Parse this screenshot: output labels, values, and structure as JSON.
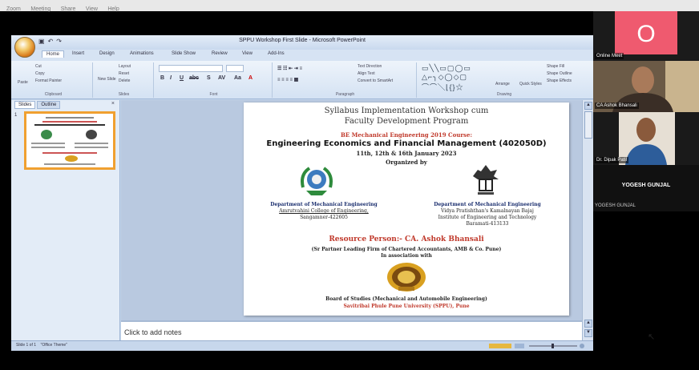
{
  "os_menu": [
    "Zoom",
    "Meeting",
    "Share",
    "View",
    "Help"
  ],
  "window": {
    "title": "SPPU Workshop First Slide - Microsoft PowerPoint",
    "tabs": [
      "Home",
      "Insert",
      "Design",
      "Animations",
      "Slide Show",
      "Review",
      "View",
      "Add-Ins"
    ]
  },
  "ribbon": {
    "clipboard": {
      "cut": "Cut",
      "copy": "Copy",
      "paste": "Paste",
      "format_painter": "Format Painter",
      "label": "Clipboard"
    },
    "slides": {
      "layout": "Layout",
      "reset": "Reset",
      "new_slide": "New Slide",
      "delete": "Delete",
      "label": "Slides"
    },
    "font": {
      "label": "Font"
    },
    "paragraph": {
      "text_direction": "Text Direction",
      "align_text": "Align Text",
      "convert_smartart": "Convert to SmartArt",
      "label": "Paragraph"
    },
    "drawing": {
      "arrange": "Arrange",
      "quick_styles": "Quick Styles",
      "shape_fill": "Shape Fill",
      "shape_outline": "Shape Outline",
      "shape_effects": "Shape Effects",
      "label": "Drawing"
    }
  },
  "pane": {
    "tabs": [
      "Slides",
      "Outline"
    ],
    "slide_number": "1"
  },
  "slide": {
    "title1": "Syllabus Implementation Workshop cum",
    "title2": "Faculty Development Program",
    "course": "BE Mechanical Engineering 2019 Course:",
    "subject": "Engineering Economics and Financial Management (402050D)",
    "dates": "11th, 12th & 16th January 2023",
    "organized": "Organized by",
    "dept_left": {
      "head": "Department of Mechanical Engineering",
      "l1": "Amrutvahini College of Engineering,",
      "l2": "Sangamner-422605"
    },
    "dept_right": {
      "head": "Department of Mechanical Engineering",
      "l1": "Vidya Pratishthan's Kamalnayan Bajaj",
      "l2": "Institute of Engineering and Technology",
      "l3": "Baramati-413133"
    },
    "resource": "Resource Person:- CA. Ashok Bhansali",
    "resource_desc": "(Sr Partner Leading Firm of Chartered Accountants, AMB & Co. Pune)",
    "association": "In association with",
    "board": "Board of Studies (Mechanical and Automobile Engineering)",
    "university": "Savitribai Phule Pune University (SPPU), Pune"
  },
  "notes_placeholder": "Click to add notes",
  "status": {
    "slide_info": "Slide 1 of 1",
    "theme": "\"Office Theme\""
  },
  "participants": [
    {
      "initial": "O",
      "name": "Online Meet"
    },
    {
      "name": "CA Ashok Bhansali"
    },
    {
      "name": "Dr. Dipak Patil"
    },
    {
      "name": "YOGESH GUNJAL",
      "sub": "YOGESH GUNJAL"
    }
  ],
  "colors": {
    "accent_red": "#c0392b",
    "avatar_pink": "#ef5a6f",
    "ribbon_blue": "#c5d6ea"
  }
}
